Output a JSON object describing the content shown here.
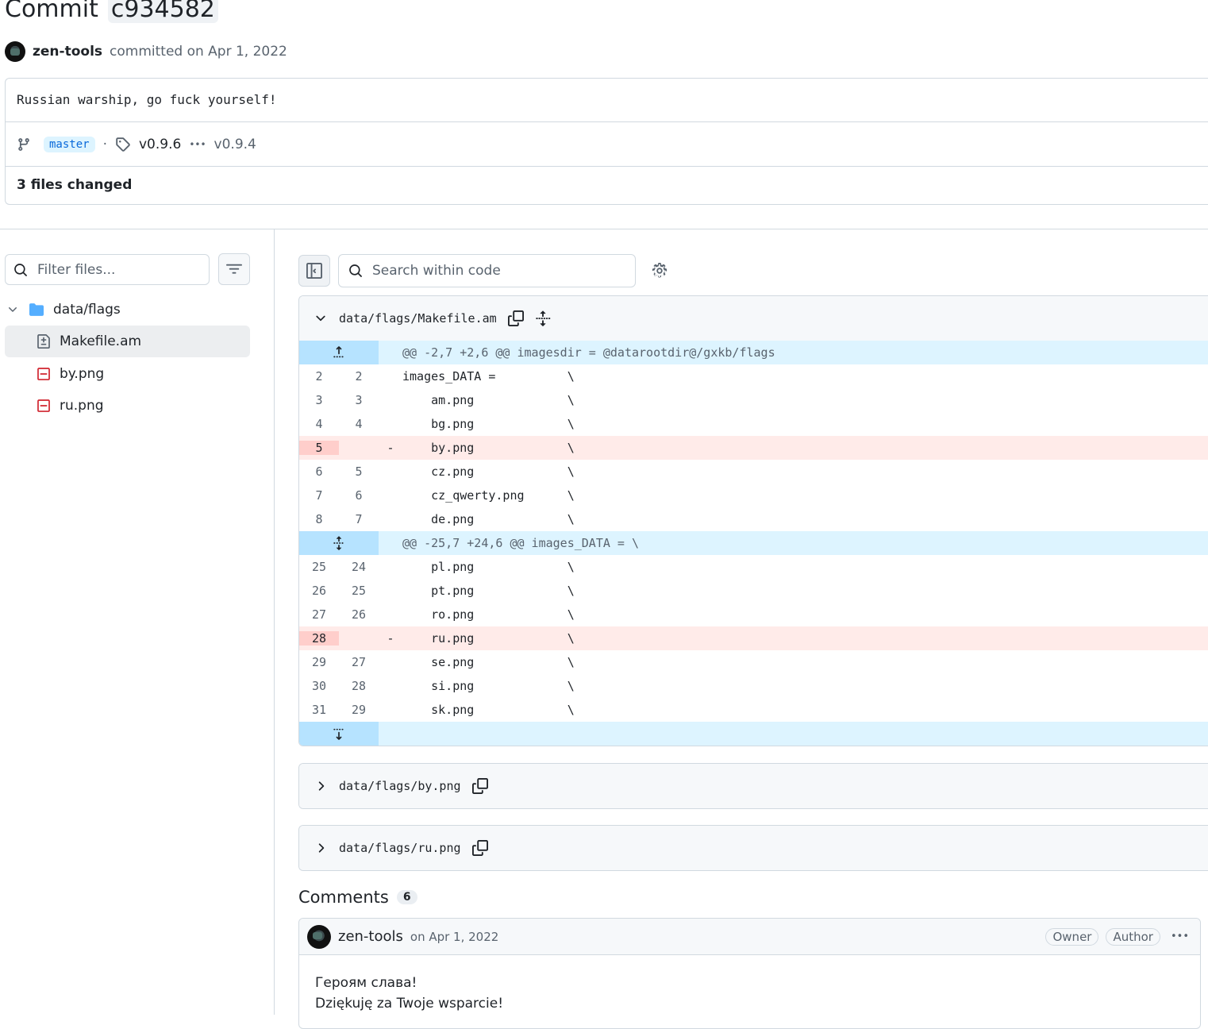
{
  "commit": {
    "label": "Commit",
    "sha": "c934582",
    "author": "zen-tools",
    "committed_text": "committed on Apr 1, 2022",
    "message": "Russian warship, go fuck yourself!",
    "branch": "master",
    "separator": "·",
    "tag_new": "v0.9.6",
    "ellipsis": "•••",
    "tag_old": "v0.9.4",
    "files_changed": "3 files changed"
  },
  "sidebar": {
    "filter_placeholder": "Filter files...",
    "folder": "data/flags",
    "files": [
      {
        "name": "Makefile.am",
        "status": "modified"
      },
      {
        "name": "by.png",
        "status": "deleted"
      },
      {
        "name": "ru.png",
        "status": "deleted"
      }
    ]
  },
  "toolbar": {
    "search_placeholder": "Search within code"
  },
  "diff": {
    "file_path": "data/flags/Makefile.am",
    "hunks": [
      {
        "header": "@@ -2,7 +2,6 @@ imagesdir = @datarootdir@/gxkb/flags",
        "lines": [
          {
            "old": "2",
            "new": "2",
            "type": "ctx",
            "code": "images_DATA =          \\"
          },
          {
            "old": "3",
            "new": "3",
            "type": "ctx",
            "code": "    am.png             \\"
          },
          {
            "old": "4",
            "new": "4",
            "type": "ctx",
            "code": "    bg.png             \\"
          },
          {
            "old": "5",
            "new": "",
            "type": "del",
            "code": "    by.png             \\"
          },
          {
            "old": "6",
            "new": "5",
            "type": "ctx",
            "code": "    cz.png             \\"
          },
          {
            "old": "7",
            "new": "6",
            "type": "ctx",
            "code": "    cz_qwerty.png      \\"
          },
          {
            "old": "8",
            "new": "7",
            "type": "ctx",
            "code": "    de.png             \\"
          }
        ]
      },
      {
        "header": "@@ -25,7 +24,6 @@ images_DATA = \\",
        "lines": [
          {
            "old": "25",
            "new": "24",
            "type": "ctx",
            "code": "    pl.png             \\"
          },
          {
            "old": "26",
            "new": "25",
            "type": "ctx",
            "code": "    pt.png             \\"
          },
          {
            "old": "27",
            "new": "26",
            "type": "ctx",
            "code": "    ro.png             \\"
          },
          {
            "old": "28",
            "new": "",
            "type": "del",
            "code": "    ru.png             \\"
          },
          {
            "old": "29",
            "new": "27",
            "type": "ctx",
            "code": "    se.png             \\"
          },
          {
            "old": "30",
            "new": "28",
            "type": "ctx",
            "code": "    si.png             \\"
          },
          {
            "old": "31",
            "new": "29",
            "type": "ctx",
            "code": "    sk.png             \\"
          }
        ]
      }
    ],
    "collapsed_files": [
      "data/flags/by.png",
      "data/flags/ru.png"
    ]
  },
  "comments": {
    "title": "Comments",
    "count": "6",
    "first": {
      "author": "zen-tools",
      "date": "on Apr 1, 2022",
      "badges": [
        "Owner",
        "Author"
      ],
      "menu": "•••",
      "body_lines": [
        "Героям слава!",
        "Dziękuję za Twoje wsparcie!"
      ]
    }
  },
  "colors": {
    "hunk_bg": "#ddf4ff",
    "deletion_bg": "#ffebe9",
    "deletion_number_bg": "#ffcecb",
    "accent": "#0969da",
    "deleted_icon": "#d1242f"
  }
}
